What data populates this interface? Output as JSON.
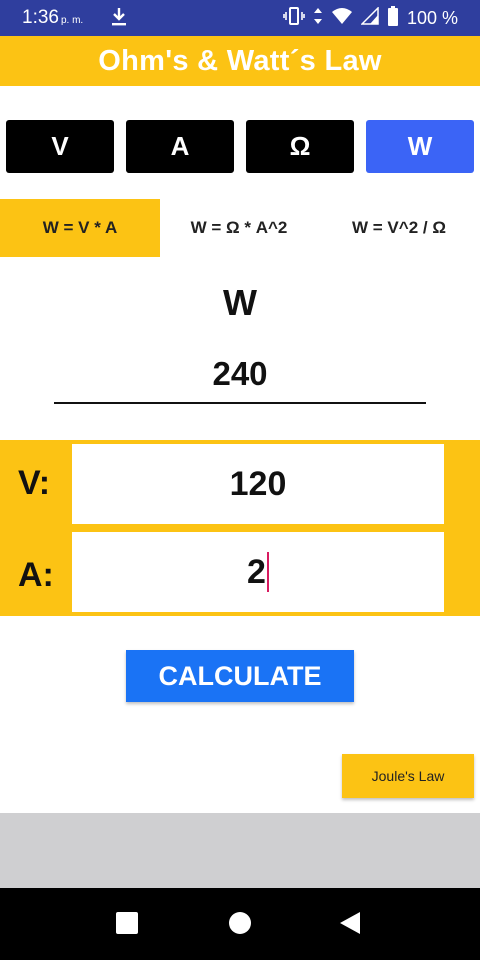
{
  "status_bar": {
    "time": "1:36",
    "ampm": "p. m.",
    "battery": "100 %",
    "icons": [
      "download-icon",
      "vibrate-icon",
      "data-arrows-icon",
      "wifi-icon",
      "signal-icon",
      "battery-icon"
    ]
  },
  "app": {
    "title": "Ohm's & Watt´s Law"
  },
  "mode_buttons": [
    {
      "label": "V",
      "active": false
    },
    {
      "label": "A",
      "active": false
    },
    {
      "label": "Ω",
      "active": false
    },
    {
      "label": "W",
      "active": true
    }
  ],
  "formula_tabs": [
    {
      "label": "W  =  V  *  A",
      "active": true
    },
    {
      "label": "W = Ω  * A^2",
      "active": false
    },
    {
      "label": "W = V^2 / Ω",
      "active": false
    }
  ],
  "result": {
    "label": "W",
    "value": "240"
  },
  "inputs": [
    {
      "label": "V:",
      "value": "120"
    },
    {
      "label": "A:",
      "value": "2"
    }
  ],
  "actions": {
    "calculate": "CALCULATE",
    "joules_law": "Joule's Law"
  },
  "colors": {
    "status_bar": "#2f3e9e",
    "accent_yellow": "#fcc314",
    "active_mode": "#3b64f6",
    "calculate_blue": "#1a73f5",
    "caret": "#d81b60"
  },
  "nav_icons": [
    "recents-square-icon",
    "home-circle-icon",
    "back-triangle-icon"
  ]
}
